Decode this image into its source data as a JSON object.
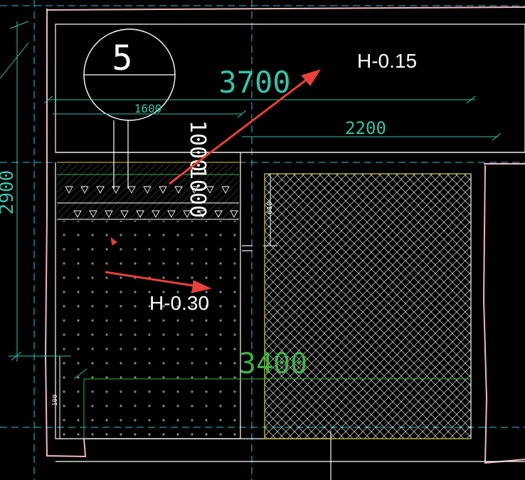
{
  "drawing": {
    "colors": {
      "background": "#000000",
      "wall_outline": "#f4b6c2",
      "dimension": "#39c0a8",
      "cyan_dash": "#27c3d8",
      "yellow": "#d6d24a",
      "green": "#3fb04a",
      "white": "#ffffff",
      "arrow": "#e8403a"
    },
    "grid_bubble": {
      "label": "5"
    },
    "dimensions": {
      "top_span": "3700",
      "sub_span_left": "1600",
      "sub_span_right": "2200",
      "vertical_left": "2900",
      "vertical_mid": "1000",
      "vertical_mid_lower": "1000",
      "bottom_span": "3400",
      "small_610": "610",
      "small_100": "100"
    },
    "annotations": [
      {
        "id": "upper",
        "text": "H-0.15"
      },
      {
        "id": "lower",
        "text": "H-0.30"
      }
    ]
  }
}
